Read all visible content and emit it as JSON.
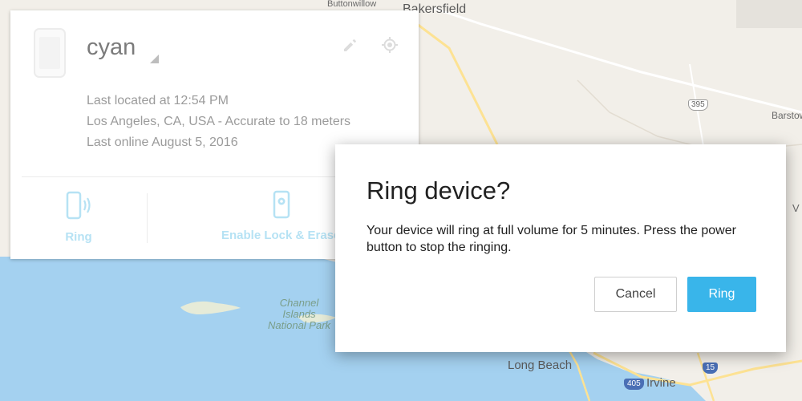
{
  "map": {
    "labels": {
      "buttonwillow": "Buttonwillow",
      "bakersfield": "Bakersfield",
      "barstow": "Barstow",
      "route_395": "395",
      "channel_islands": "Channel",
      "channel_islands_2": "Islands",
      "channel_islands_3": "National Park",
      "long_beach": "Long Beach",
      "irvine": "Irvine",
      "route_405": "405",
      "route_15": "15",
      "edge_v": "V"
    },
    "colors": {
      "land": "#f2efe9",
      "water": "#a4d1f0",
      "road": "#fde293",
      "park": "#cfe4cd"
    }
  },
  "device_card": {
    "name": "cyan",
    "last_located": "Last located at 12:54 PM",
    "location": "Los Angeles, CA, USA - Accurate to 18 meters",
    "last_online": "Last online August 5, 2016",
    "actions": {
      "ring_label": "Ring",
      "lock_label": "Enable Lock & Erase"
    },
    "icons": {
      "edit": "pencil-icon",
      "locate": "locate-icon",
      "ring": "phone-ring-icon",
      "lock": "phone-settings-icon"
    },
    "accent": "#b6e2f4"
  },
  "dialog": {
    "title": "Ring device?",
    "body": "Your device will ring at full volume for 5 minutes. Press the power button to stop the ringing.",
    "cancel_label": "Cancel",
    "ring_label": "Ring",
    "ring_color": "#39b5ea"
  }
}
